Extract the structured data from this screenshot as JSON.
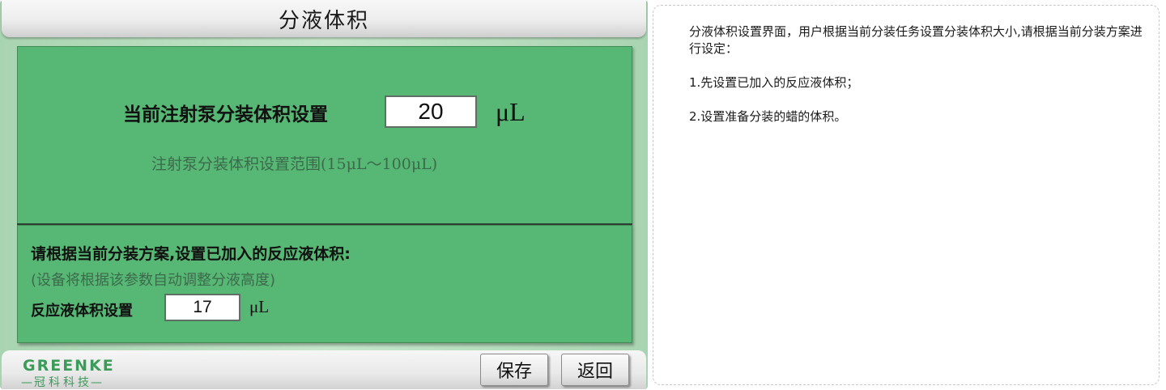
{
  "screen": {
    "title": "分液体积",
    "volume": {
      "label": "当前注射泵分装体积设置",
      "value": "20",
      "unit": "μL",
      "range_note": "注射泵分装体积设置范围(15μL～100μL)"
    },
    "instructions": {
      "title": "请根据当前分装方案,设置已加入的反应液体积:",
      "subtitle": "(设备将根据该参数自动调整分液高度)"
    },
    "reaction": {
      "label": "反应液体积设置",
      "value": "17",
      "unit": "μL"
    },
    "footer": {
      "logo_main": "GREENKE",
      "logo_sub": "冠科科技",
      "save_label": "保存",
      "back_label": "返回"
    }
  },
  "description": {
    "intro": "分液体积设置界面，用户根据当前分装任务设置分装体积大小,请根据当前分装方案进行设定：",
    "step1": "1.先设置已加入的反应液体积；",
    "step2": "2.设置准备分装的蜡的体积。"
  },
  "colors": {
    "panel_green": "#57b774",
    "brand_green": "#3a9c58"
  }
}
